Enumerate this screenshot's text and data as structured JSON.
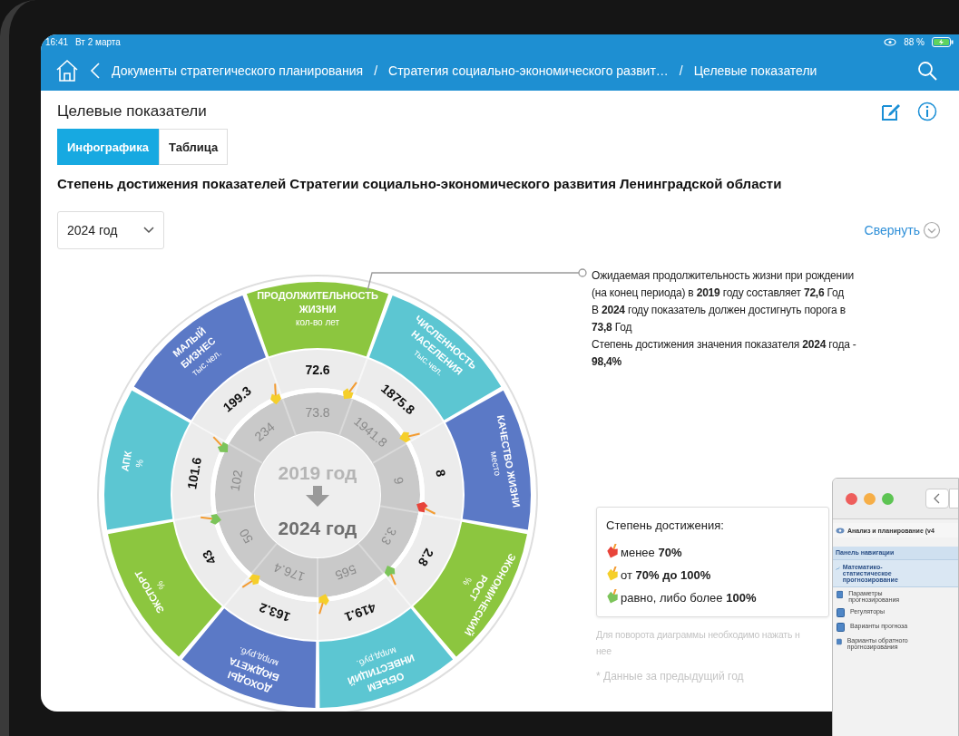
{
  "status_bar": {
    "time": "16:41",
    "date": "Вт 2 марта",
    "battery": "88 %"
  },
  "nav": {
    "breadcrumbs": [
      {
        "label": "Документы стратегического планирования"
      },
      {
        "separator": "/",
        "label": "Стратегия социально-экономического развит…"
      },
      {
        "separator": "/",
        "label": "Целевые показатели"
      }
    ]
  },
  "page": {
    "title": "Целевые показатели",
    "tabs": [
      {
        "label": "Инфографика",
        "selected": true
      },
      {
        "label": "Таблица",
        "selected": false
      }
    ],
    "heading": "Степень достижения показателей Стратегии социально-экономического развития Ленинградской области",
    "year_select": {
      "value": "2024 год"
    },
    "collapse_link": "Свернуть"
  },
  "wheel": {
    "center_from": "2019 год",
    "center_to": "2024 год",
    "sectors": [
      {
        "title": [
          "ПРОДОЛЖИТЕЛЬНОСТЬ",
          "ЖИЗНИ"
        ],
        "unit": "кол-во лет",
        "value": "72.6",
        "target": "73.8",
        "color": "#8cc63f",
        "dart": {
          "color": "#f5cf2a"
        }
      },
      {
        "title": [
          "ЧИСЛЕННОСТЬ",
          "НАСЕЛЕНИЯ"
        ],
        "unit": "тыс.чел.",
        "value": "1875.8",
        "target": "1941.8",
        "color": "#5cc6d2",
        "dart": {
          "color": "#f5cf2a"
        }
      },
      {
        "title": [
          "КАЧЕСТВО ЖИЗНИ"
        ],
        "unit": "место",
        "value": "8",
        "target": "9",
        "color": "#5b79c6",
        "dart": {
          "color": "#e8443a"
        }
      },
      {
        "title": [
          "ЭКОНОМИЧЕСКИЙ",
          "РОСТ"
        ],
        "unit": "%",
        "value": "2.8",
        "target": "3.3",
        "color": "#8cc63f",
        "dart": {
          "color": "#7cc45a"
        }
      },
      {
        "title": [
          "ОБЪЕМ",
          "ИНВЕСТИЦИЙ"
        ],
        "unit": "млрд.руб.",
        "value": "419.1",
        "target": "565",
        "color": "#5cc6d2",
        "dart": {
          "color": "#f5cf2a"
        }
      },
      {
        "title": [
          "ДОХОДЫ",
          "БЮДЖЕТА"
        ],
        "unit": "млрд.руб.",
        "value": "163.2",
        "target": "176.4",
        "color": "#5b79c6",
        "dart": {
          "color": "#f5cf2a"
        }
      },
      {
        "title": [
          "ЭКСПОРТ"
        ],
        "unit": "%",
        "value": "43",
        "target": "50",
        "color": "#8cc63f",
        "dart": {
          "color": "#7cc45a"
        }
      },
      {
        "title": [
          "АПК"
        ],
        "unit": "%",
        "value": "101.6",
        "target": "102",
        "color": "#5cc6d2",
        "dart": {
          "color": "#7cc45a"
        }
      },
      {
        "title": [
          "МАЛЫЙ",
          "БИЗНЕС"
        ],
        "unit": "тыс.чел.",
        "value": "199.3",
        "target": "234",
        "color": "#5b79c6",
        "dart": {
          "color": "#f5cf2a"
        }
      }
    ]
  },
  "tooltip": {
    "paragraphs": [
      "Ожидаемая продолжительность жизни при рождении (на конец периода) в **2019** году составляет **72,6** Год",
      "В **2024** году показатель должен достигнуть порога в **73,8** Год",
      "Степень достижения значения показателя **2024** года - **98,4%**"
    ]
  },
  "legend": {
    "title": "Степень достижения:",
    "items": [
      {
        "color": "#e8443a",
        "text": "менее **70%**"
      },
      {
        "color": "#f5cf2a",
        "text": "от **70% до 100%**"
      },
      {
        "color": "#7cc45a",
        "text": "равно, либо более **100%**"
      }
    ]
  },
  "hint_lines": [
    "Для поворота диаграммы необходимо нажать н",
    "нее"
  ],
  "footnote": "* Данные за предыдущий год",
  "overlay_window": {
    "toolbar_title": "Анализ и планирование (v4",
    "panel_title": "Панель навигации",
    "section": "Математико-статистическое прогнозирование",
    "items": [
      "Параметры прогнозирования",
      "Регуляторы",
      "Варианты прогноза",
      "Варианты обратного прогнозирования"
    ]
  }
}
